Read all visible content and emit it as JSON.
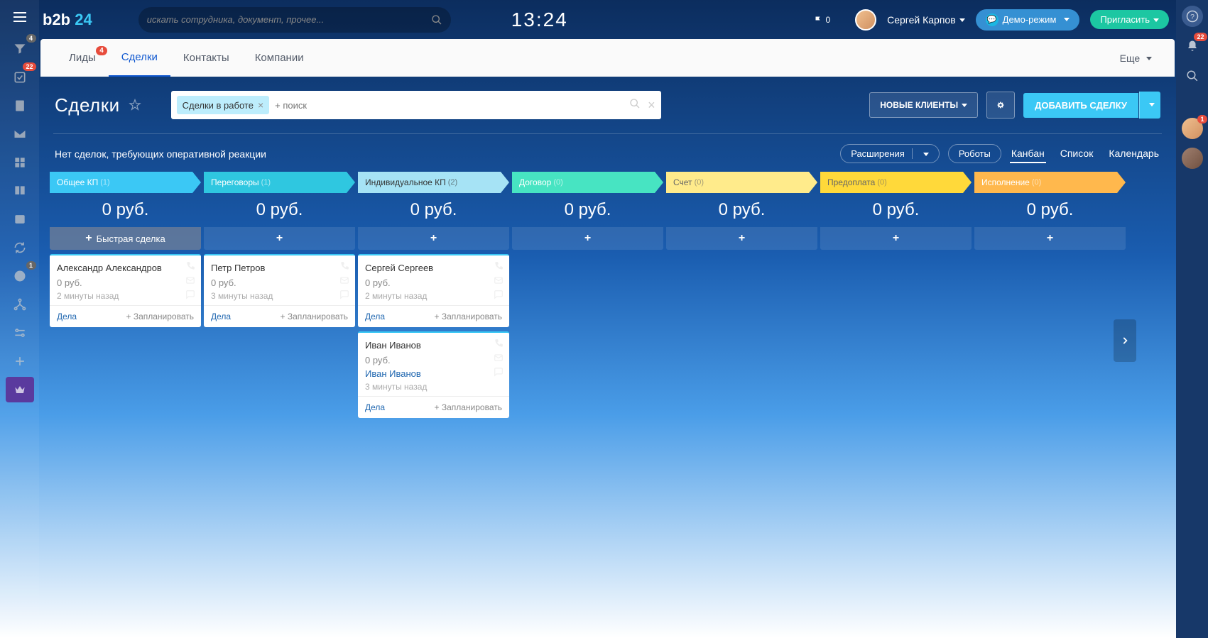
{
  "header": {
    "logo_a": "b2b ",
    "logo_b": "24",
    "search_placeholder": "искать сотрудника, документ, прочее...",
    "clock": "13:24",
    "flag_count": "0",
    "user": "Сергей Карпов",
    "demo": "Демо-режим",
    "invite": "Пригласить"
  },
  "sidebar_badges": {
    "funnel": "4",
    "check": "22",
    "clock": "1"
  },
  "tabs": {
    "items": [
      {
        "label": "Лиды",
        "badge": "4"
      },
      {
        "label": "Сделки",
        "active": true
      },
      {
        "label": "Контакты"
      },
      {
        "label": "Компании"
      }
    ],
    "more": "Еще"
  },
  "toolbar": {
    "title": "Сделки",
    "filter_tag": "Сделки в работе",
    "filter_placeholder": "+ поиск",
    "new_clients": "НОВЫЕ КЛИЕНТЫ",
    "add_deal": "ДОБАВИТЬ СДЕЛКУ"
  },
  "sub": {
    "msg": "Нет сделок, требующих оперативной реакции",
    "ext": "Расширения",
    "robots": "Роботы",
    "views": [
      {
        "label": "Канбан",
        "active": true
      },
      {
        "label": "Список"
      },
      {
        "label": "Календарь"
      }
    ]
  },
  "kanban": {
    "quick_add": "Быстрая сделка",
    "dela": "Дела",
    "plan": "+ Запланировать",
    "columns": [
      {
        "name": "Общее КП",
        "count": "(1)",
        "sum": "0 руб.",
        "color": "#3bc8f5",
        "txt": "#fff",
        "quick": true,
        "cards": [
          {
            "title": "Александр Александров",
            "price": "0 руб.",
            "time": "2 минуты назад"
          }
        ]
      },
      {
        "name": "Переговоры",
        "count": "(1)",
        "sum": "0 руб.",
        "color": "#2fc7e0",
        "txt": "#fff",
        "cards": [
          {
            "title": "Петр Петров",
            "price": "0 руб.",
            "time": "3 минуты назад"
          }
        ]
      },
      {
        "name": "Индивидуальное КП",
        "count": "(2)",
        "sum": "0 руб.",
        "color": "#a6e3f5",
        "txt": "#333",
        "cards": [
          {
            "title": "Сергей Сергеев",
            "price": "0 руб.",
            "time": "2 минуты назад"
          },
          {
            "title": "Иван Иванов",
            "price": "0 руб.",
            "link": "Иван Иванов",
            "time": "3 минуты назад"
          }
        ]
      },
      {
        "name": "Договор",
        "count": "(0)",
        "sum": "0 руб.",
        "color": "#47e4c2",
        "txt": "#fff",
        "cards": []
      },
      {
        "name": "Счет",
        "count": "(0)",
        "sum": "0 руб.",
        "color": "#ffeb8b",
        "txt": "#666",
        "cards": []
      },
      {
        "name": "Предоплата",
        "count": "(0)",
        "sum": "0 руб.",
        "color": "#ffd93a",
        "txt": "#666",
        "cards": []
      },
      {
        "name": "Исполнение",
        "count": "(0)",
        "sum": "0 руб.",
        "color": "#ffb84d",
        "txt": "#fff",
        "cards": []
      }
    ]
  },
  "right_badges": {
    "bell": "22",
    "av1": "1"
  }
}
